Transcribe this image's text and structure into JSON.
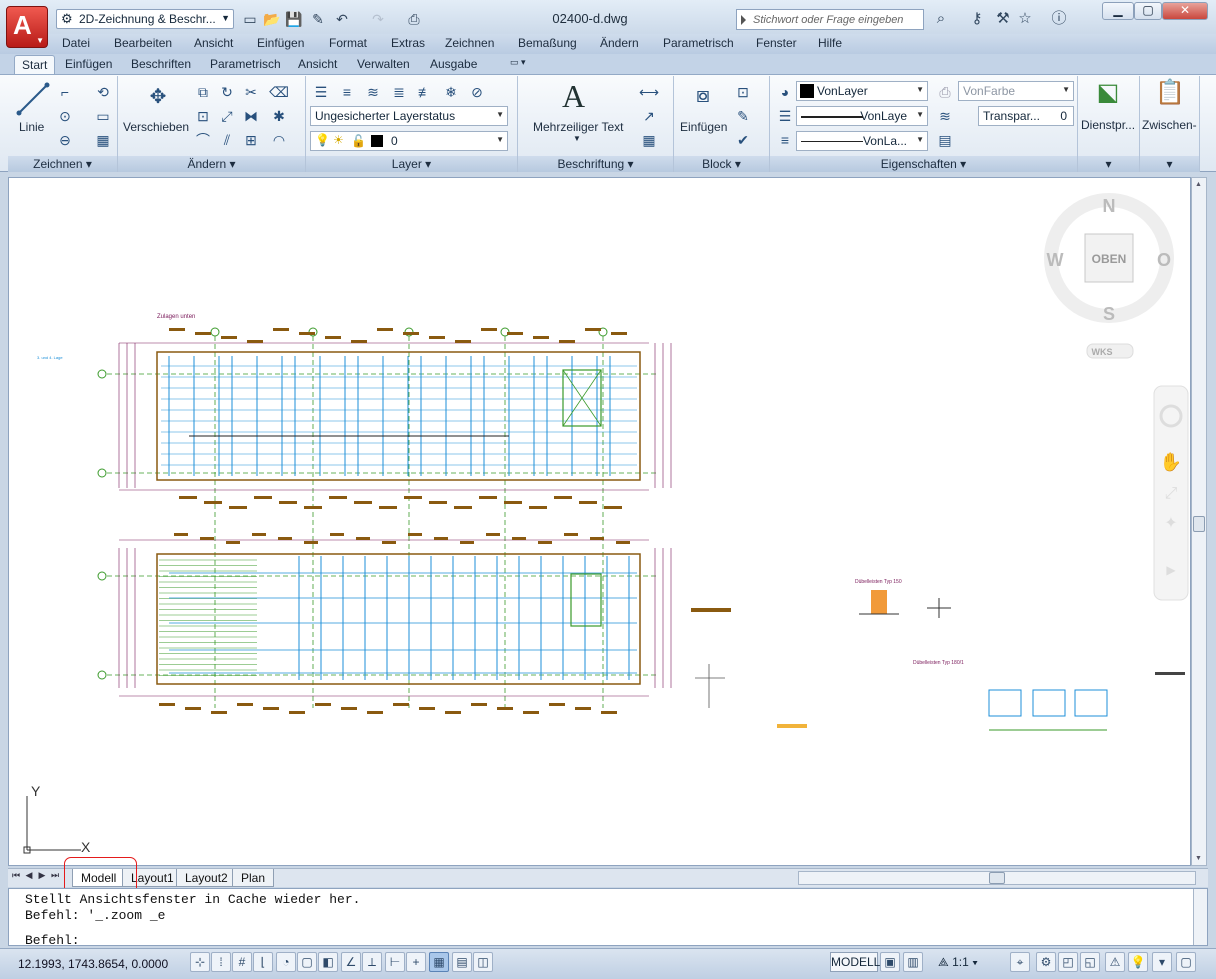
{
  "titlebar": {
    "app_button_letter": "A",
    "workspace": "2D-Zeichnung & Beschr...",
    "document_title": "02400-d.dwg",
    "search_placeholder": "Stichwort oder Frage eingeben"
  },
  "menu": [
    "Datei",
    "Bearbeiten",
    "Ansicht",
    "Einfügen",
    "Format",
    "Extras",
    "Zeichnen",
    "Bemaßung",
    "Ändern",
    "Parametrisch",
    "Fenster",
    "Hilfe"
  ],
  "ribbon_tabs": [
    "Start",
    "Einfügen",
    "Beschriften",
    "Parametrisch",
    "Ansicht",
    "Verwalten",
    "Ausgabe"
  ],
  "panels": {
    "zeichnen": {
      "title": "Zeichnen",
      "linie": "Linie"
    },
    "aendern": {
      "title": "Ändern",
      "verschieben": "Verschieben"
    },
    "layer": {
      "title": "Layer",
      "status": "Ungesicherter Layerstatus",
      "current": "0"
    },
    "beschriftung": {
      "title": "Beschriftung",
      "mtext": "Mehrzeiliger Text"
    },
    "block": {
      "title": "Block",
      "einfuegen": "Einfügen"
    },
    "eigenschaften": {
      "title": "Eigenschaften",
      "color": "VonLayer",
      "linetype": "VonLaye",
      "lineweight": "VonLa...",
      "plotstyle": "VonFarbe",
      "transparency": "Transpar...",
      "transparency_value": "0"
    },
    "dienstprogramme": {
      "title": "Dienstpr..."
    },
    "zwischenablage": {
      "title": "Zwischen-"
    }
  },
  "viewcube": {
    "n": "N",
    "s": "S",
    "w": "W",
    "o": "O",
    "face": "OBEN",
    "ucs": "WKS"
  },
  "drawing": {
    "title_top": "Zulagen unten",
    "note": "3. und 4. Lage",
    "legend1": "Dübelleisten Typ 150",
    "legend2": "Dübelleisten Typ 180/1",
    "ucs_x": "X",
    "ucs_y": "Y"
  },
  "layout_tabs": [
    "Modell",
    "Layout1",
    "Layout2",
    "Plan"
  ],
  "command": {
    "line1": "Stellt Ansichtsfenster in Cache wieder her.",
    "line2": "Befehl: '_.zoom _e",
    "prompt": "Befehl:"
  },
  "status": {
    "coords": "12.1993,  1743.8654, 0.0000",
    "modell": "MODELL",
    "scale": "1:1"
  },
  "colors": {
    "accent_red": "#e41b1b",
    "drawing_blue": "#1c8fd8",
    "drawing_brown": "#8a5a10",
    "drawing_purple": "#7a1a5a",
    "drawing_green": "#3a9a2a"
  }
}
